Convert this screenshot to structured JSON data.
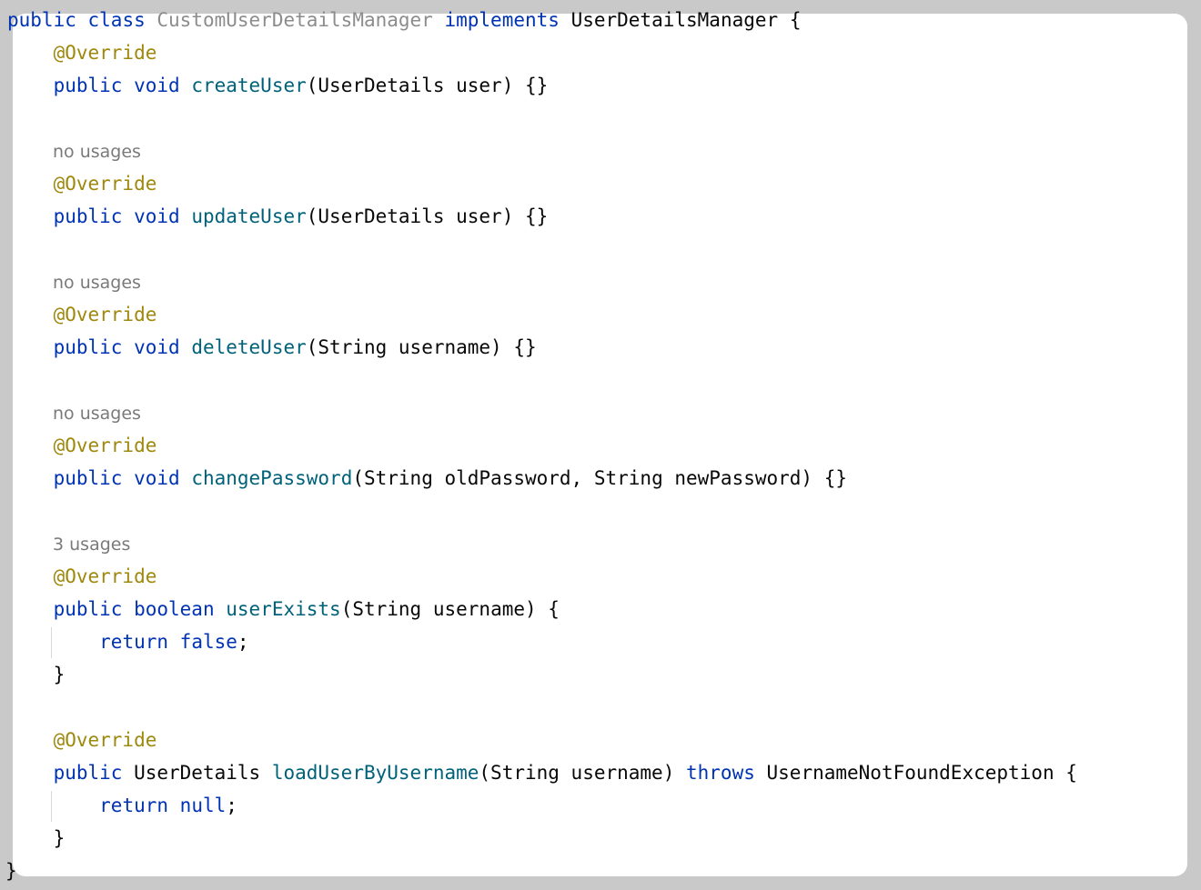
{
  "code": {
    "class_decl": {
      "kw1": "public",
      "kw2": "class",
      "name": "CustomUserDetailsManager",
      "kw3": "implements",
      "iface": "UserDetailsManager",
      "brace": "{"
    },
    "annotation": "@Override",
    "indent": "    ",
    "indent2": "        ",
    "kw_public": "public",
    "kw_void": "void",
    "kw_boolean": "boolean",
    "kw_return": "return",
    "kw_false": "false",
    "kw_null": "null",
    "kw_throws": "throws",
    "hints": {
      "no_usages": "no usages",
      "three_usages": "3 usages"
    },
    "create_user": {
      "name": "createUser",
      "params": "(UserDetails user) {}"
    },
    "update_user": {
      "name": "updateUser",
      "params": "(UserDetails user) {}"
    },
    "delete_user": {
      "name": "deleteUser",
      "params": "(String username) {}"
    },
    "change_password": {
      "name": "changePassword",
      "params": "(String oldPassword, String newPassword) {}"
    },
    "user_exists": {
      "name": "userExists",
      "params": "(String username) {",
      "semicolon": ";"
    },
    "load_user": {
      "type": "UserDetails",
      "name": "loadUserByUsername",
      "params": "(String username)",
      "exception": "UsernameNotFoundException {",
      "semicolon": ";"
    },
    "close_brace": "}"
  }
}
